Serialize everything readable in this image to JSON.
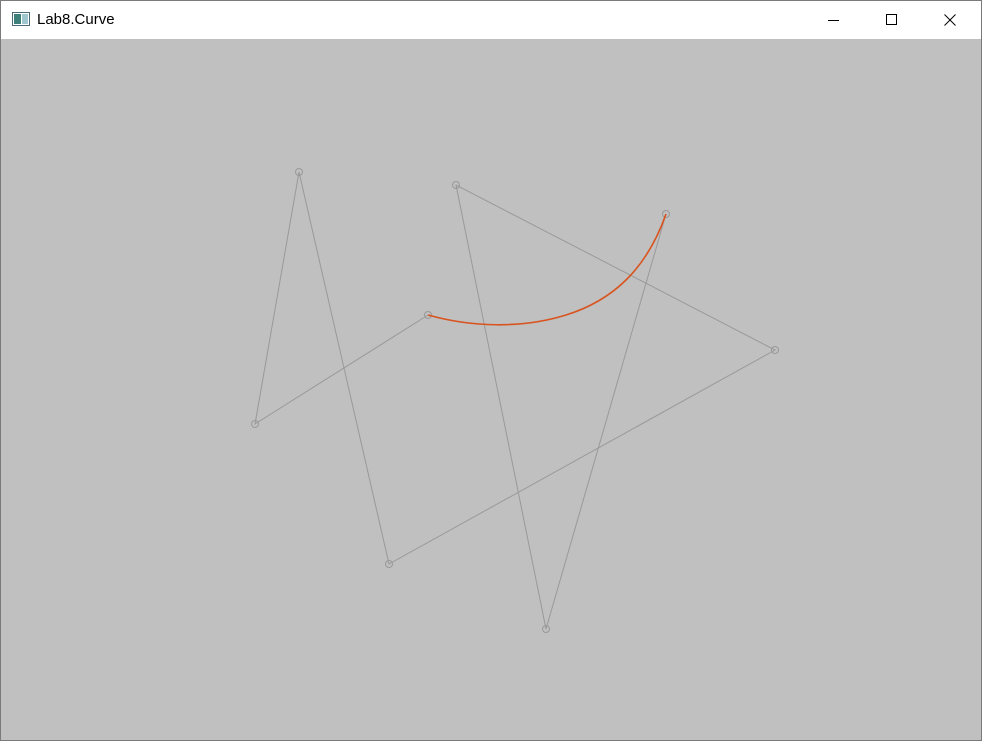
{
  "window": {
    "title": "Lab8.Curve",
    "controls": {
      "minimize": "minimize-icon",
      "maximize": "maximize-icon",
      "close": "close-icon"
    }
  },
  "canvas": {
    "background": "#c0c0c0",
    "polygon_color": "#999999",
    "curve_color": "#d9531e"
  }
}
